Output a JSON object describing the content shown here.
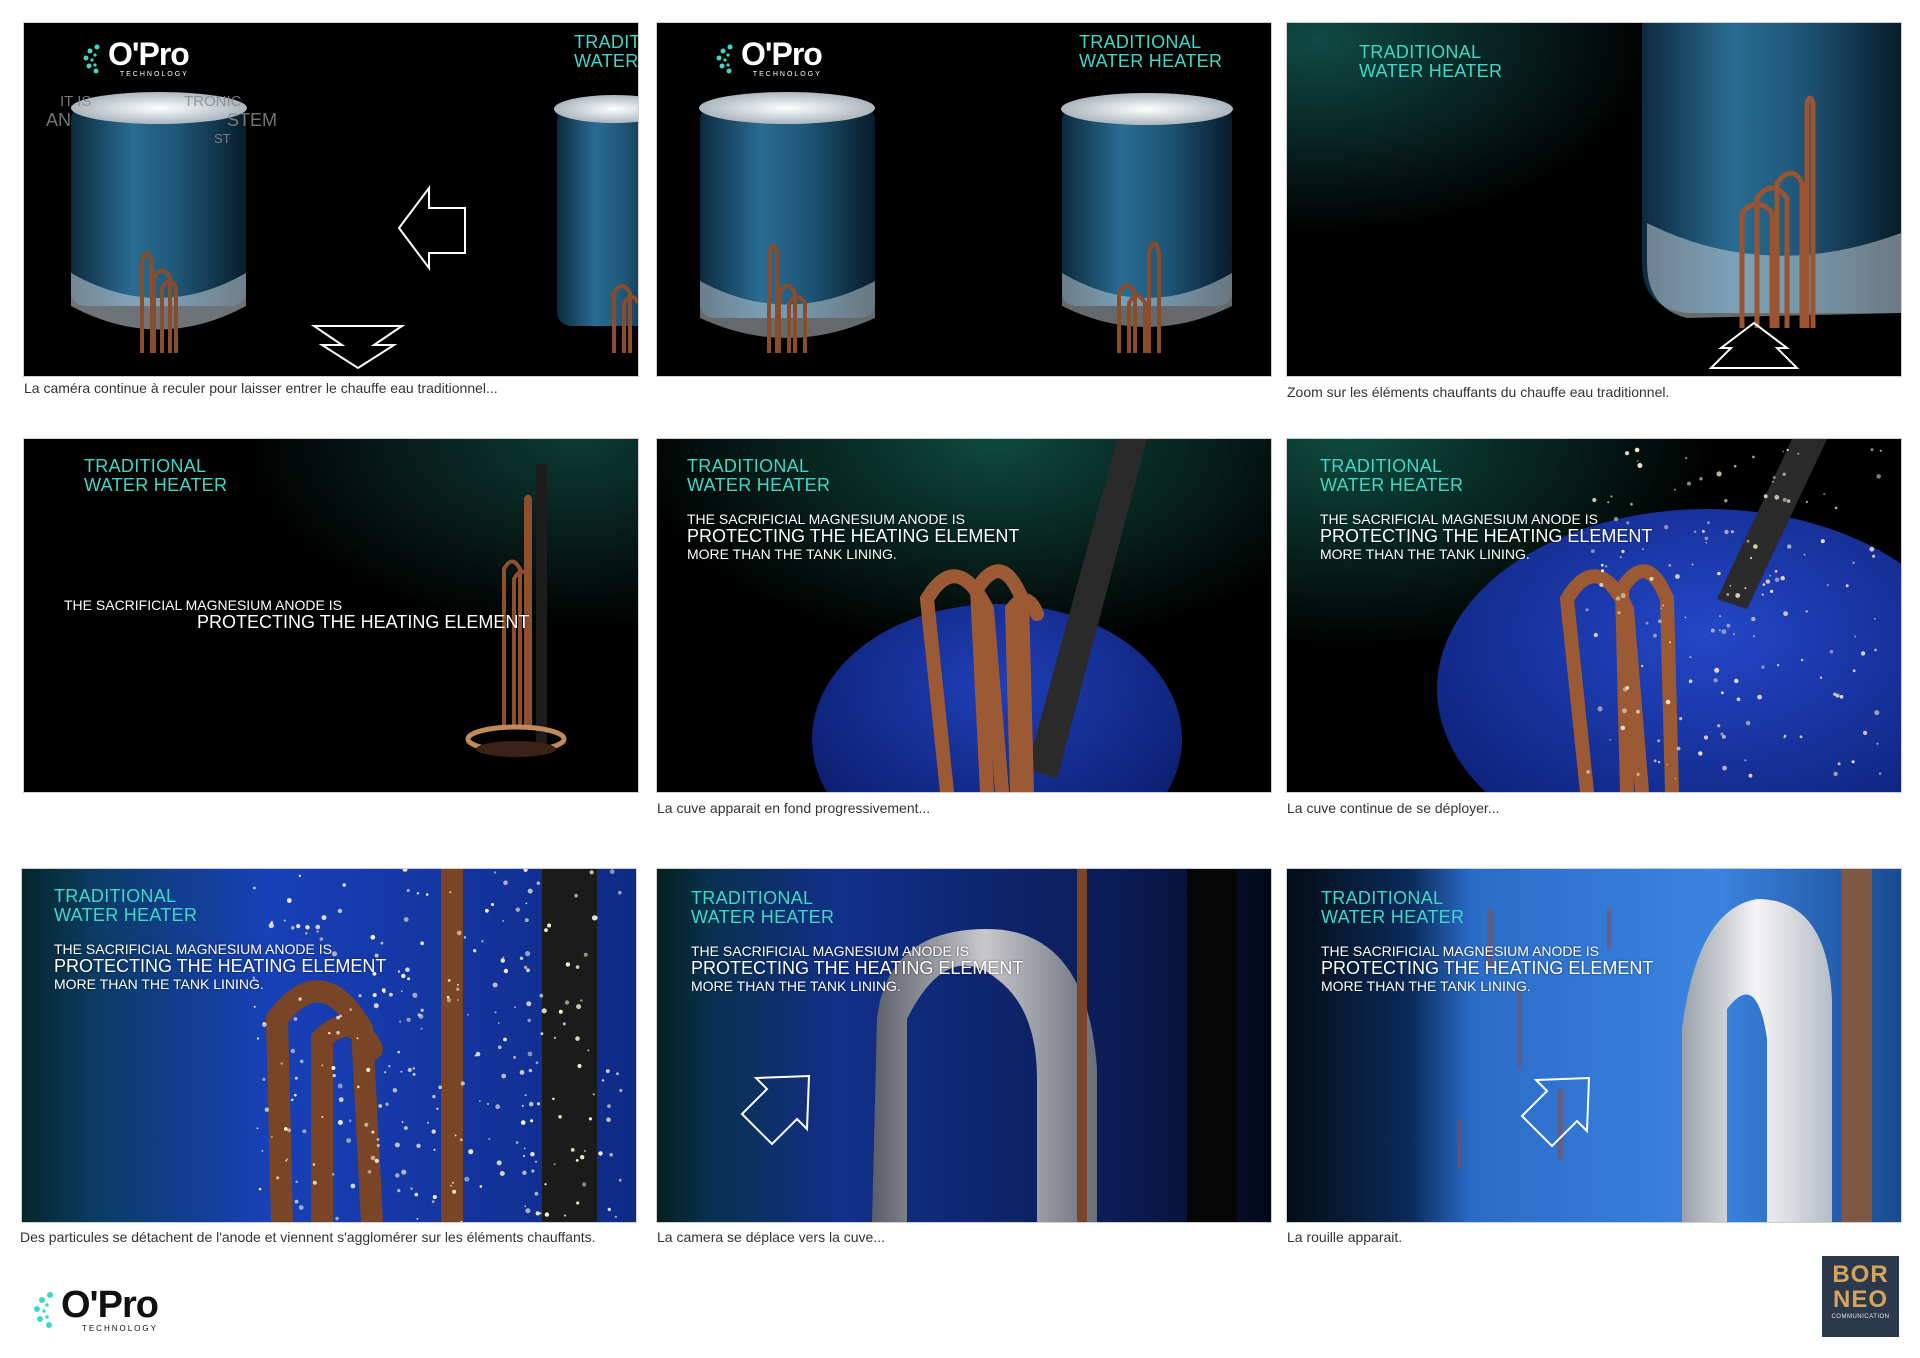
{
  "brand": {
    "logo_word": "O'Pro",
    "logo_sub": "TECHNOLOGY",
    "agency_line1": "BOR",
    "agency_line2": "NEO",
    "agency_sub": "COMMUNICATION"
  },
  "frames": [
    {
      "id": 1,
      "header_lines": [
        "TRADIT",
        "WATER"
      ],
      "ghost_text": [
        "IT IS",
        "TRONIC",
        "AN",
        "STEM",
        "ST"
      ],
      "caption": "La caméra continue à reculer pour laisser entrer le chauffe eau traditionnel..."
    },
    {
      "id": 2,
      "header_lines": [
        "TRADITIONAL",
        "WATER HEATER"
      ],
      "caption": ""
    },
    {
      "id": 3,
      "header_lines": [
        "TRADITIONAL",
        "WATER HEATER"
      ],
      "caption": "Zoom sur les éléments chauffants du chauffe eau traditionnel."
    },
    {
      "id": 4,
      "header_lines": [
        "TRADITIONAL",
        "WATER HEATER"
      ],
      "text_l1": "THE SACRIFICIAL MAGNESIUM ANODE IS",
      "text_l2": "PROTECTING THE HEATING ELEMENT",
      "caption": ""
    },
    {
      "id": 5,
      "header_lines": [
        "TRADITIONAL",
        "WATER HEATER"
      ],
      "text_l1": "THE SACRIFICIAL MAGNESIUM ANODE IS",
      "text_l2": "PROTECTING THE HEATING ELEMENT",
      "text_l3": "MORE THAN THE TANK LINING.",
      "caption": "La cuve apparait en fond progressivement..."
    },
    {
      "id": 6,
      "header_lines": [
        "TRADITIONAL",
        "WATER HEATER"
      ],
      "text_l1": "THE SACRIFICIAL MAGNESIUM ANODE IS",
      "text_l2": "PROTECTING THE HEATING ELEMENT",
      "text_l3": "MORE THAN THE TANK LINING.",
      "caption": "La cuve continue de se déployer..."
    },
    {
      "id": 7,
      "header_lines": [
        "TRADITIONAL",
        "WATER HEATER"
      ],
      "text_l1": "THE SACRIFICIAL MAGNESIUM ANODE IS",
      "text_l2": "PROTECTING THE HEATING ELEMENT",
      "text_l3": "MORE THAN THE TANK LINING.",
      "caption": "Des particules se détachent de l'anode et viennent s'agglomérer sur les éléments chauffants."
    },
    {
      "id": 8,
      "header_lines": [
        "TRADITIONAL",
        "WATER HEATER"
      ],
      "text_l1": "THE SACRIFICIAL MAGNESIUM ANODE IS",
      "text_l2": "PROTECTING THE HEATING ELEMENT",
      "text_l3": "MORE THAN THE TANK LINING.",
      "caption": "La camera se déplace vers la cuve..."
    },
    {
      "id": 9,
      "header_lines": [
        "TRADITIONAL",
        "WATER HEATER"
      ],
      "text_l1": "THE SACRIFICIAL MAGNESIUM ANODE IS",
      "text_l2": "PROTECTING THE HEATING ELEMENT",
      "text_l3": "MORE THAN THE TANK LINING.",
      "caption": "La rouille apparait."
    }
  ],
  "colors": {
    "accent_teal": "#3fd8c8",
    "tank_blue": "#1d5f86",
    "deep_blue": "#1632a0",
    "copper": "#b36a3c",
    "caption_text": "#333333"
  },
  "icons": [
    "arrow-left-icon",
    "arrow-down-icon",
    "arrow-up-icon",
    "arrow-up-right-icon",
    "opro-dots-icon"
  ]
}
